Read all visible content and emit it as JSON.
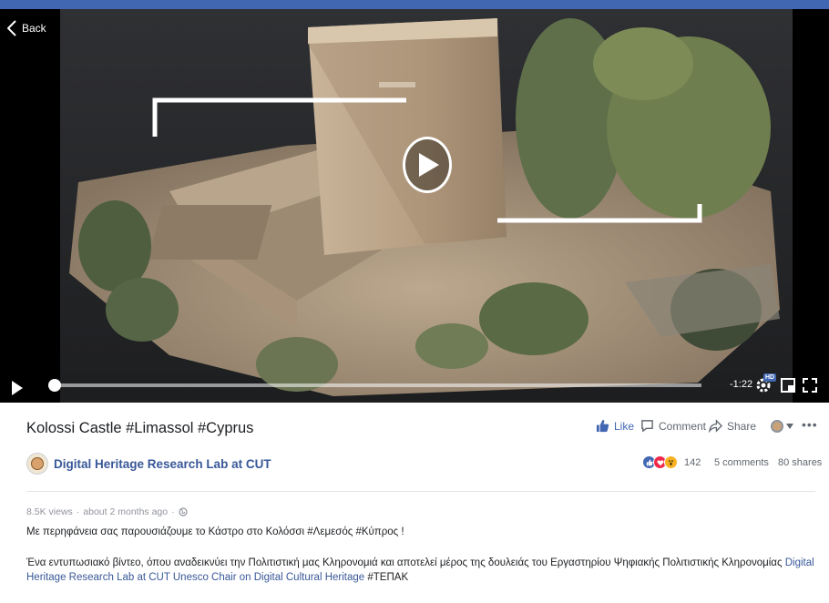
{
  "video": {
    "back_label": "Back",
    "time_remaining": "-1:22",
    "hd_badge": "HD",
    "progress_fraction": 0.0
  },
  "post": {
    "title": "Kolossi Castle #Limassol #Cyprus",
    "actions": {
      "like": "Like",
      "comment": "Comment",
      "share": "Share"
    },
    "page_name": "Digital Heritage Research Lab at CUT",
    "reactions_count": "142",
    "comments_count": "5 comments",
    "shares_count": "80 shares",
    "views": "8.5K views",
    "time_ago": "about 2 months ago",
    "separator": "·",
    "description_line1": "Με περηφάνεια σας παρουσιάζουμε το Κάστρο στο Κολόσσι #Λεμεσός #Κύπρος !",
    "description_p2_text": "Ένα εντυπωσιακό βίντεο, όπου αναδεικνύει την Πολιτιστική μας Κληρονομιά και αποτελεί μέρος της δουλειάς του Εργαστηρίου Ψηφιακής Πολιτιστικής Κληρονομίας ",
    "description_p2_link1": "Digital Heritage Research Lab at CUT",
    "description_p2_link2": "Unesco Chair on Digital Cultural Heritage",
    "description_p2_tag": "#ΤΕΠΑΚ"
  },
  "colors": {
    "brand_blue": "#4267b2",
    "link_blue": "#385898",
    "muted_text": "#606770"
  },
  "icons": {
    "like": "thumbs-up-icon",
    "comment": "speech-bubble-icon",
    "share": "share-arrow-icon",
    "reactions": [
      "like-reaction-icon",
      "love-reaction-icon",
      "wow-reaction-icon"
    ]
  }
}
